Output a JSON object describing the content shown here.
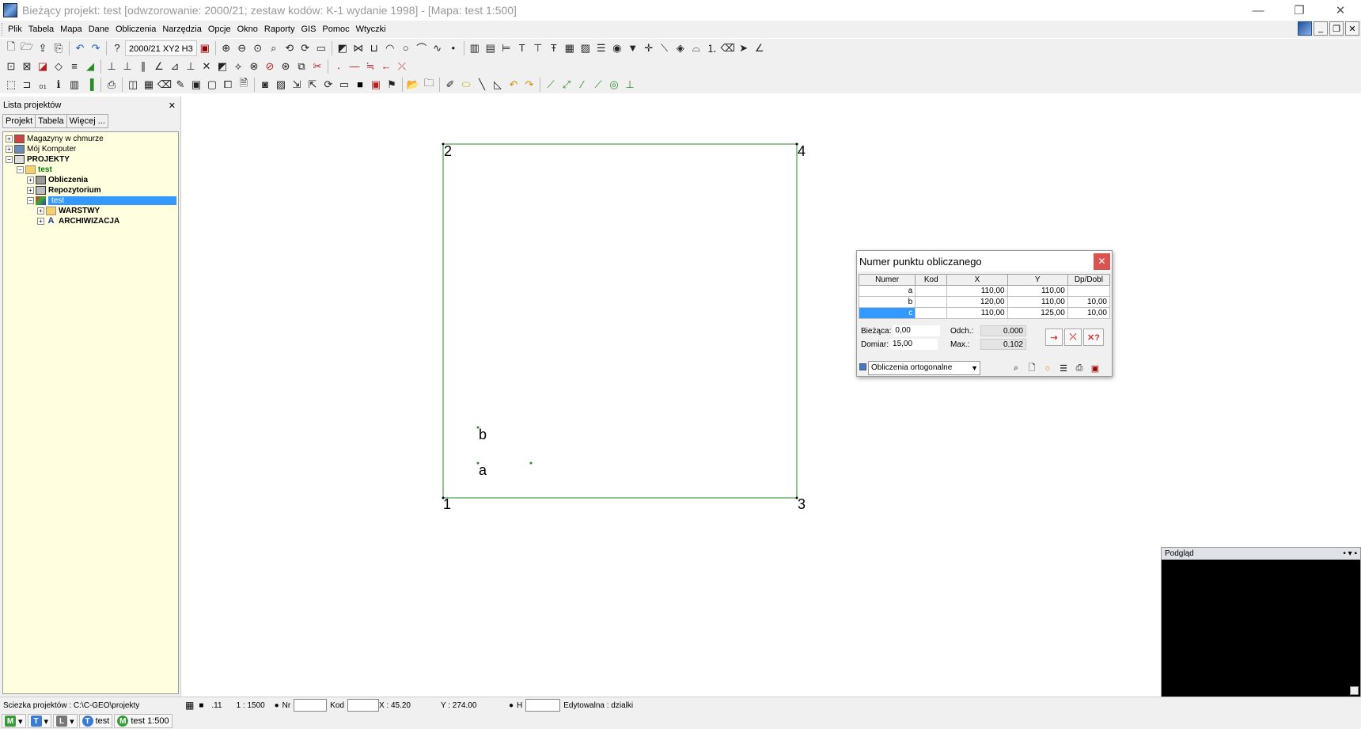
{
  "window": {
    "title": "Bieżący projekt: test [odwzorowanie: 2000/21; zestaw kodów: K-1 wydanie 1998] - [Mapa: test  1:500]",
    "controls": [
      "—",
      "❐",
      "✕"
    ]
  },
  "menu": [
    "Plik",
    "Tabela",
    "Mapa",
    "Dane",
    "Obliczenia",
    "Narzędzia",
    "Opcje",
    "Okno",
    "Raporty",
    "GIS",
    "Pomoc",
    "Wtyczki"
  ],
  "toolbar": {
    "coord_system_label": "2000/21 XY2 H3"
  },
  "project_panel": {
    "title": "Lista projektów",
    "close": "✕",
    "tabs": [
      "Projekt",
      "Tabela",
      "Więcej ..."
    ],
    "tree": [
      {
        "label": "Magazyny w chmurze",
        "style": "normal"
      },
      {
        "label": "Mój Komputer",
        "style": "normal"
      },
      {
        "label": "PROJEKTY",
        "style": "bold"
      },
      {
        "label": "test",
        "style": "green"
      },
      {
        "label": "Obliczenia",
        "style": "bold"
      },
      {
        "label": "Repozytorium",
        "style": "bold"
      },
      {
        "label": "test",
        "style": "selected"
      },
      {
        "label": "WARSTWY",
        "style": "bold"
      },
      {
        "label": "ARCHIWIZACJA",
        "style": "bold"
      }
    ]
  },
  "map": {
    "corner_labels": [
      "1",
      "2",
      "3",
      "4"
    ],
    "point_labels": [
      "a",
      "b"
    ]
  },
  "dialog": {
    "title": "Numer punktu obliczanego",
    "columns": [
      "Numer",
      "Kod",
      "X",
      "Y",
      "Dp/Dobl"
    ],
    "rows": [
      {
        "numer": "a",
        "kod": "",
        "x": "110,00",
        "y": "110,00",
        "dp": ""
      },
      {
        "numer": "b",
        "kod": "",
        "x": "120,00",
        "y": "110,00",
        "dp": "10,00"
      },
      {
        "numer": "c",
        "kod": "",
        "x": "110,00",
        "y": "125,00",
        "dp": "10,00"
      }
    ],
    "biezaca_label": "Bieżąca:",
    "biezaca_value": "0,00",
    "domiar_label": "Domiar:",
    "domiar_value": "15,00",
    "odch_label": "Odch.:",
    "odch_value": "0.000",
    "max_label": "Max.:",
    "max_value": "0.102",
    "mode": "Obliczenia ortogonalne"
  },
  "preview": {
    "title": "Podgląd",
    "controls": "• ▾ ▪"
  },
  "statusbar": {
    "path": "Sciezka projektów : C:\\C-GEO\\projekty",
    "dot": ".11",
    "scale": "1 : 1500",
    "nr_label": "Nr",
    "kod_label": "Kod",
    "x_coord": "X : 45.20",
    "y_coord": "Y : 274.00",
    "h_label": "H",
    "editable": "Edytowalna : dzialki"
  },
  "taskbar": {
    "items": [
      {
        "badge": "M",
        "color": "#3a9b3a",
        "label": ""
      },
      {
        "badge": "T",
        "color": "#3a7bd5",
        "label": ""
      },
      {
        "badge": "L",
        "color": "#777777",
        "label": ""
      },
      {
        "badge": "T",
        "color": "#3a7bd5",
        "label": "test"
      },
      {
        "badge": "M",
        "color": "#3a9b3a",
        "label": "test  1:500"
      }
    ]
  },
  "colors": {
    "accent": "#3399ff",
    "map_line": "#2a8a2a",
    "tree_bg": "#ffffe0",
    "close_red": "#d9534f"
  }
}
